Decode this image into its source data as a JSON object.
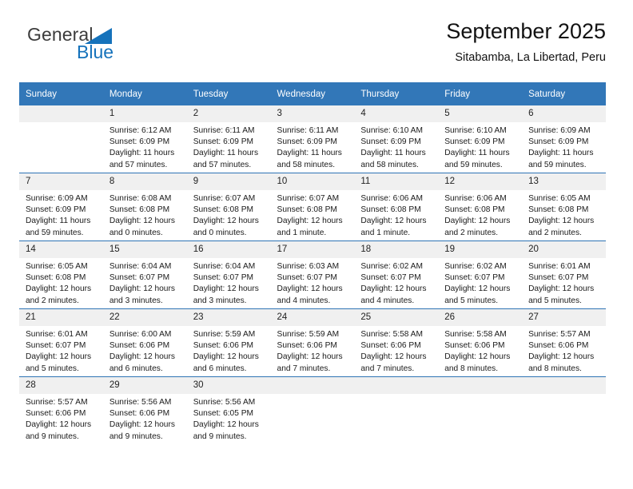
{
  "brand": {
    "line1": "General",
    "line2": "Blue",
    "triangle_icon": "blue-triangle-icon",
    "color_text": "#3c3c3c",
    "color_blue": "#1572bb"
  },
  "header": {
    "title": "September 2025",
    "subtitle": "Sitabamba, La Libertad, Peru"
  },
  "theme": {
    "header_blue": "#3277b8",
    "rule_blue": "#2e74b5",
    "daynum_band": "#f0f0f0"
  },
  "calendar": {
    "weekday_headers": [
      "Sunday",
      "Monday",
      "Tuesday",
      "Wednesday",
      "Thursday",
      "Friday",
      "Saturday"
    ],
    "labels": {
      "sunrise": "Sunrise:",
      "sunset": "Sunset:",
      "daylight": "Daylight:"
    },
    "weeks": [
      [
        {
          "day": "",
          "l1": "",
          "l2": "",
          "l3": "",
          "l4": ""
        },
        {
          "day": "1",
          "l1": "Sunrise: 6:12 AM",
          "l2": "Sunset: 6:09 PM",
          "l3": "Daylight: 11 hours",
          "l4": "and 57 minutes."
        },
        {
          "day": "2",
          "l1": "Sunrise: 6:11 AM",
          "l2": "Sunset: 6:09 PM",
          "l3": "Daylight: 11 hours",
          "l4": "and 57 minutes."
        },
        {
          "day": "3",
          "l1": "Sunrise: 6:11 AM",
          "l2": "Sunset: 6:09 PM",
          "l3": "Daylight: 11 hours",
          "l4": "and 58 minutes."
        },
        {
          "day": "4",
          "l1": "Sunrise: 6:10 AM",
          "l2": "Sunset: 6:09 PM",
          "l3": "Daylight: 11 hours",
          "l4": "and 58 minutes."
        },
        {
          "day": "5",
          "l1": "Sunrise: 6:10 AM",
          "l2": "Sunset: 6:09 PM",
          "l3": "Daylight: 11 hours",
          "l4": "and 59 minutes."
        },
        {
          "day": "6",
          "l1": "Sunrise: 6:09 AM",
          "l2": "Sunset: 6:09 PM",
          "l3": "Daylight: 11 hours",
          "l4": "and 59 minutes."
        }
      ],
      [
        {
          "day": "7",
          "l1": "Sunrise: 6:09 AM",
          "l2": "Sunset: 6:09 PM",
          "l3": "Daylight: 11 hours",
          "l4": "and 59 minutes."
        },
        {
          "day": "8",
          "l1": "Sunrise: 6:08 AM",
          "l2": "Sunset: 6:08 PM",
          "l3": "Daylight: 12 hours",
          "l4": "and 0 minutes."
        },
        {
          "day": "9",
          "l1": "Sunrise: 6:07 AM",
          "l2": "Sunset: 6:08 PM",
          "l3": "Daylight: 12 hours",
          "l4": "and 0 minutes."
        },
        {
          "day": "10",
          "l1": "Sunrise: 6:07 AM",
          "l2": "Sunset: 6:08 PM",
          "l3": "Daylight: 12 hours",
          "l4": "and 1 minute."
        },
        {
          "day": "11",
          "l1": "Sunrise: 6:06 AM",
          "l2": "Sunset: 6:08 PM",
          "l3": "Daylight: 12 hours",
          "l4": "and 1 minute."
        },
        {
          "day": "12",
          "l1": "Sunrise: 6:06 AM",
          "l2": "Sunset: 6:08 PM",
          "l3": "Daylight: 12 hours",
          "l4": "and 2 minutes."
        },
        {
          "day": "13",
          "l1": "Sunrise: 6:05 AM",
          "l2": "Sunset: 6:08 PM",
          "l3": "Daylight: 12 hours",
          "l4": "and 2 minutes."
        }
      ],
      [
        {
          "day": "14",
          "l1": "Sunrise: 6:05 AM",
          "l2": "Sunset: 6:08 PM",
          "l3": "Daylight: 12 hours",
          "l4": "and 2 minutes."
        },
        {
          "day": "15",
          "l1": "Sunrise: 6:04 AM",
          "l2": "Sunset: 6:07 PM",
          "l3": "Daylight: 12 hours",
          "l4": "and 3 minutes."
        },
        {
          "day": "16",
          "l1": "Sunrise: 6:04 AM",
          "l2": "Sunset: 6:07 PM",
          "l3": "Daylight: 12 hours",
          "l4": "and 3 minutes."
        },
        {
          "day": "17",
          "l1": "Sunrise: 6:03 AM",
          "l2": "Sunset: 6:07 PM",
          "l3": "Daylight: 12 hours",
          "l4": "and 4 minutes."
        },
        {
          "day": "18",
          "l1": "Sunrise: 6:02 AM",
          "l2": "Sunset: 6:07 PM",
          "l3": "Daylight: 12 hours",
          "l4": "and 4 minutes."
        },
        {
          "day": "19",
          "l1": "Sunrise: 6:02 AM",
          "l2": "Sunset: 6:07 PM",
          "l3": "Daylight: 12 hours",
          "l4": "and 5 minutes."
        },
        {
          "day": "20",
          "l1": "Sunrise: 6:01 AM",
          "l2": "Sunset: 6:07 PM",
          "l3": "Daylight: 12 hours",
          "l4": "and 5 minutes."
        }
      ],
      [
        {
          "day": "21",
          "l1": "Sunrise: 6:01 AM",
          "l2": "Sunset: 6:07 PM",
          "l3": "Daylight: 12 hours",
          "l4": "and 5 minutes."
        },
        {
          "day": "22",
          "l1": "Sunrise: 6:00 AM",
          "l2": "Sunset: 6:06 PM",
          "l3": "Daylight: 12 hours",
          "l4": "and 6 minutes."
        },
        {
          "day": "23",
          "l1": "Sunrise: 5:59 AM",
          "l2": "Sunset: 6:06 PM",
          "l3": "Daylight: 12 hours",
          "l4": "and 6 minutes."
        },
        {
          "day": "24",
          "l1": "Sunrise: 5:59 AM",
          "l2": "Sunset: 6:06 PM",
          "l3": "Daylight: 12 hours",
          "l4": "and 7 minutes."
        },
        {
          "day": "25",
          "l1": "Sunrise: 5:58 AM",
          "l2": "Sunset: 6:06 PM",
          "l3": "Daylight: 12 hours",
          "l4": "and 7 minutes."
        },
        {
          "day": "26",
          "l1": "Sunrise: 5:58 AM",
          "l2": "Sunset: 6:06 PM",
          "l3": "Daylight: 12 hours",
          "l4": "and 8 minutes."
        },
        {
          "day": "27",
          "l1": "Sunrise: 5:57 AM",
          "l2": "Sunset: 6:06 PM",
          "l3": "Daylight: 12 hours",
          "l4": "and 8 minutes."
        }
      ],
      [
        {
          "day": "28",
          "l1": "Sunrise: 5:57 AM",
          "l2": "Sunset: 6:06 PM",
          "l3": "Daylight: 12 hours",
          "l4": "and 9 minutes."
        },
        {
          "day": "29",
          "l1": "Sunrise: 5:56 AM",
          "l2": "Sunset: 6:06 PM",
          "l3": "Daylight: 12 hours",
          "l4": "and 9 minutes."
        },
        {
          "day": "30",
          "l1": "Sunrise: 5:56 AM",
          "l2": "Sunset: 6:05 PM",
          "l3": "Daylight: 12 hours",
          "l4": "and 9 minutes."
        },
        {
          "day": "",
          "l1": "",
          "l2": "",
          "l3": "",
          "l4": ""
        },
        {
          "day": "",
          "l1": "",
          "l2": "",
          "l3": "",
          "l4": ""
        },
        {
          "day": "",
          "l1": "",
          "l2": "",
          "l3": "",
          "l4": ""
        },
        {
          "day": "",
          "l1": "",
          "l2": "",
          "l3": "",
          "l4": ""
        }
      ]
    ]
  }
}
